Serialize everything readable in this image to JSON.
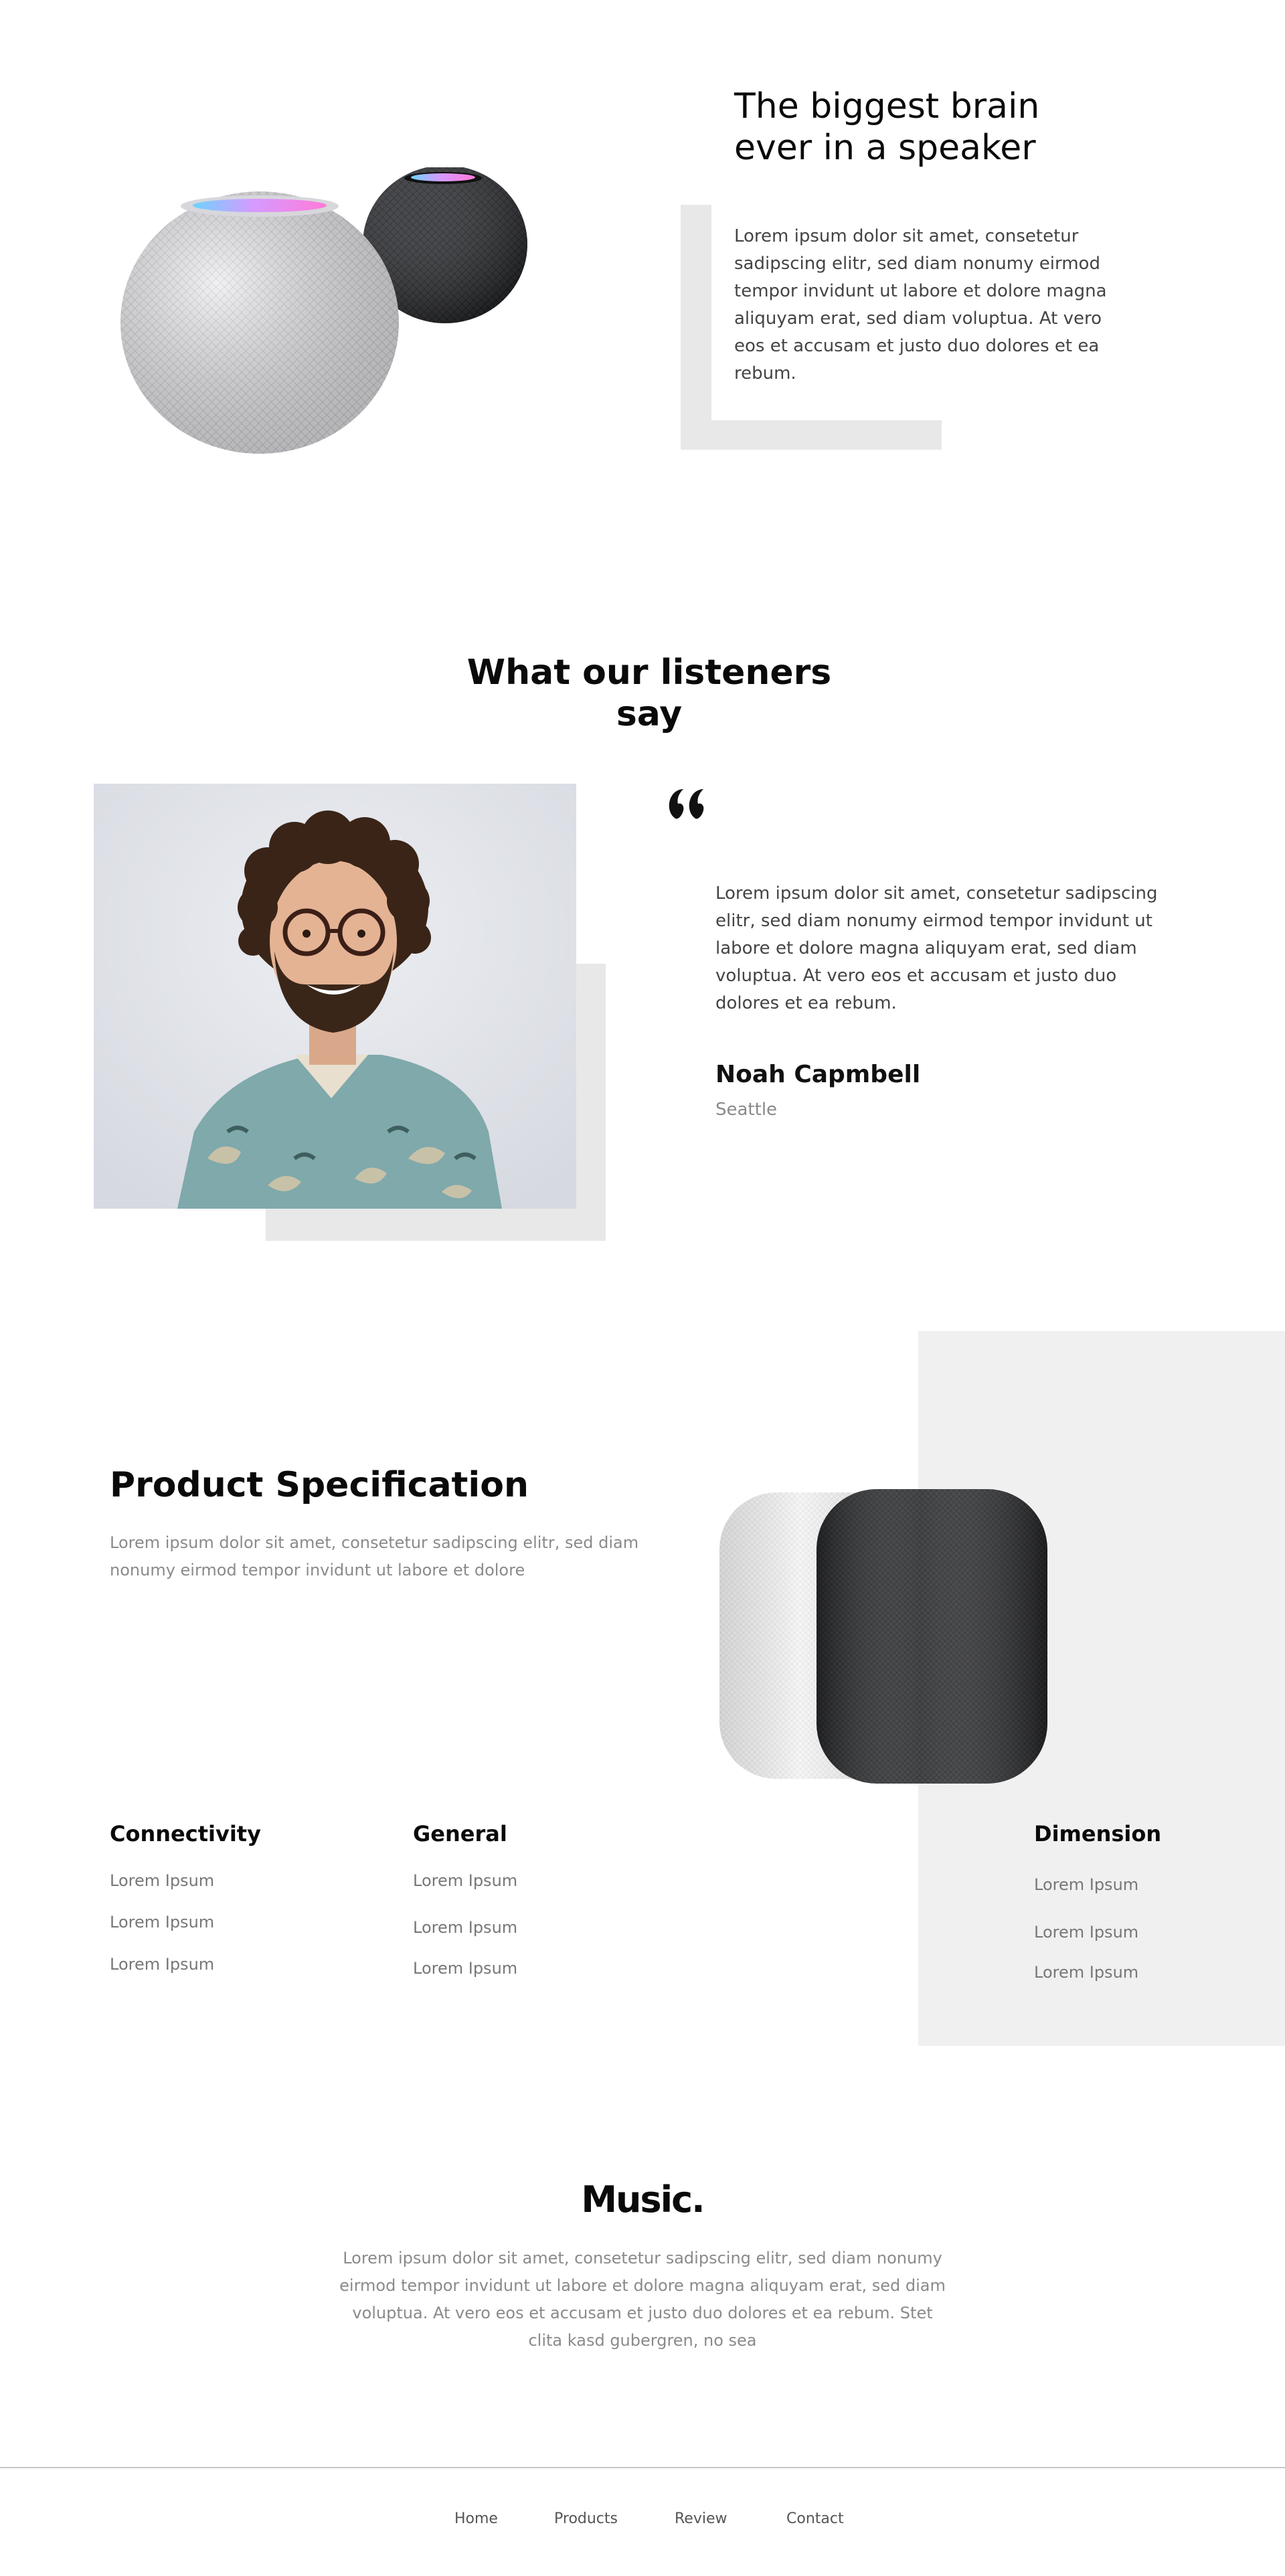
{
  "hero": {
    "title_line1": "The biggest brain",
    "title_line2": "ever in a speaker",
    "body": "Lorem ipsum dolor sit amet, consetetur sadipscing elitr, sed diam nonumy eirmod tempor invidunt ut labore et dolore magna aliquyam erat, sed diam voluptua. At vero eos et accusam et justo duo dolores et ea rebum."
  },
  "testimonials": {
    "title_line1": "What our listeners",
    "title_line2": "say",
    "quote_icon": "quote-open-icon",
    "quote": "Lorem ipsum dolor sit amet, consetetur sadipscing elitr, sed diam nonumy eirmod tempor invidunt ut labore et dolore magna aliquyam erat, sed diam voluptua. At vero eos et accusam et justo duo dolores et ea rebum.",
    "author_name": "Noah Capmbell",
    "author_city": "Seattle"
  },
  "spec": {
    "title": "Product Specification",
    "description": "Lorem ipsum dolor sit amet, consetetur sadipscing elitr, sed diam nonumy eirmod tempor invidunt ut labore et dolore",
    "columns": [
      {
        "title": "Connectivity",
        "items": [
          "Lorem Ipsum",
          "Lorem Ipsum",
          "Lorem Ipsum"
        ]
      },
      {
        "title": "General",
        "items": [
          "Lorem Ipsum",
          "Lorem Ipsum",
          "Lorem Ipsum"
        ]
      },
      {
        "title": "Dimension",
        "items": [
          "Lorem Ipsum",
          "Lorem Ipsum",
          "Lorem Ipsum"
        ]
      }
    ]
  },
  "brand": {
    "name": "Music.",
    "description": "Lorem ipsum dolor sit amet, consetetur sadipscing elitr, sed diam nonumy eirmod tempor invidunt ut labore et dolore magna aliquyam erat, sed diam voluptua. At vero eos et accusam et justo duo dolores et ea rebum. Stet clita kasd gubergren, no sea"
  },
  "footer": {
    "nav": [
      "Home",
      "Products",
      "Review",
      "Contact"
    ]
  },
  "colors": {
    "background": "#ffffff",
    "accent_gray": "#e8e8e8",
    "panel_gray": "#f0f0f0",
    "text_dark": "#0a0a0a",
    "text_muted": "#8a8a8a"
  }
}
